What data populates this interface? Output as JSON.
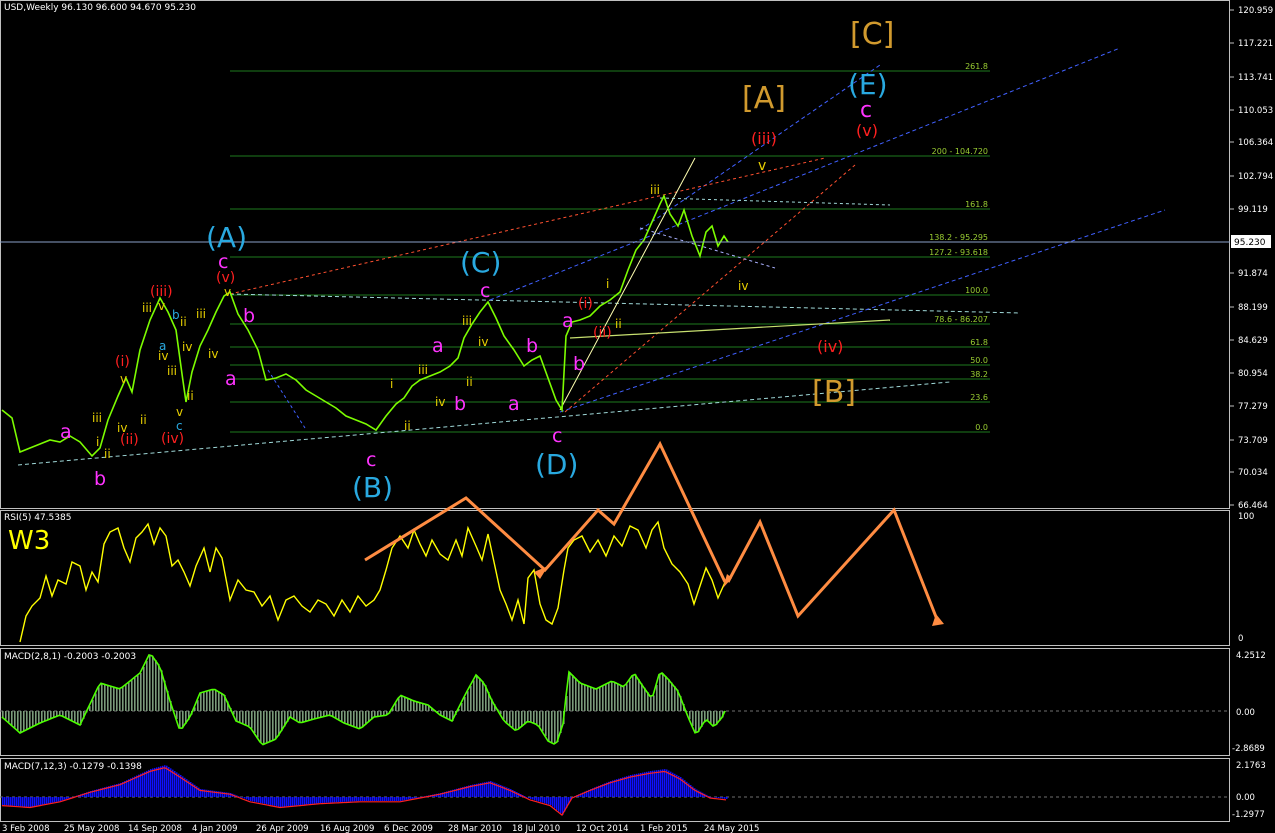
{
  "colors": {
    "background": "#000000",
    "frame": "#c0c0c0",
    "price": "#7cfc00",
    "fib": "#1e7a1e",
    "rsi": "#ffff00",
    "arrow": "#ff8c42",
    "wave_A_label": "#29a9e0",
    "wave_bracket_label": "#d19a2e",
    "magenta": "#ff33ff",
    "red_label": "#ff2020",
    "yellow_label": "#e8d000",
    "macd_hist": "#7a9a7a",
    "macd_line": "#4cff00",
    "macd2_hist": "#1010ff",
    "macd2_signal": "#ff2020",
    "price_marker_bg": "#ffffff"
  },
  "main_panel": {
    "title": "USD,Weekly  96.130 96.600 94.670 95.230",
    "current_price": "95.230",
    "price_axis": [
      "120.959",
      "117.221",
      "113.741",
      "110.053",
      "106.364",
      "102.794",
      "99.119",
      "95.230",
      "91.874",
      "88.199",
      "84.629",
      "80.954",
      "77.279",
      "73.709",
      "70.034",
      "66.464"
    ],
    "fib_labels": [
      "261.8",
      "200 - 104.720",
      "161.8",
      "138.2 - 95.295",
      "127.2 - 93.618",
      "100.0",
      "78.6 - 86.207",
      "61.8",
      "50.0",
      "38.2",
      "23.6",
      "0.0"
    ]
  },
  "wave_labels": {
    "A_paren": "(A)",
    "B_paren": "(B)",
    "C_paren": "(C)",
    "D_paren": "(D)",
    "E_paren": "(E)",
    "A_bracket": "[A]",
    "B_bracket": "[B]",
    "C_bracket": "[C]",
    "a": "a",
    "b": "b",
    "c": "c",
    "i_paren": "(i)",
    "ii_paren": "(ii)",
    "iii_paren": "(iii)",
    "iv_paren": "(iv)",
    "v_paren": "(v)",
    "i": "i",
    "ii": "ii",
    "iii": "iii",
    "iv": "iv",
    "v": "v"
  },
  "rsi_panel": {
    "title": "RSI(5) 47.5385",
    "badge": "W3",
    "axis": [
      "100",
      "0"
    ]
  },
  "macd1_panel": {
    "title": "MACD(2,8,1) -0.2003 -0.2003",
    "axis": [
      "4.2512",
      "0.00",
      "-2.8689"
    ]
  },
  "macd2_panel": {
    "title": "MACD(7,12,3) -0.1279 -0.1398",
    "axis": [
      "2.1763",
      "0.00",
      "-1.2977"
    ]
  },
  "time_axis": [
    "3 Feb 2008",
    "25 May 2008",
    "14 Sep 2008",
    "4 Jan 2009",
    "26 Apr 2009",
    "16 Aug 2009",
    "6 Dec 2009",
    "28 Mar 2010",
    "18 Jul 2010",
    "12 Oct 2014",
    "1 Feb 2015",
    "24 May 2015"
  ],
  "chart_data": {
    "type": "line",
    "title": "USD,Weekly",
    "ohlc_last": {
      "open": 96.13,
      "high": 96.6,
      "low": 94.67,
      "close": 95.23
    },
    "x": [
      "3 Feb 2008",
      "25 May 2008",
      "14 Sep 2008",
      "4 Jan 2009",
      "26 Apr 2009",
      "16 Aug 2009",
      "6 Dec 2009",
      "28 Mar 2010",
      "18 Jul 2010",
      "12 Oct 2014",
      "1 Feb 2015",
      "24 May 2015"
    ],
    "series": [
      {
        "name": "USD",
        "values": [
          73.5,
          72.5,
          86.5,
          88.2,
          81.5,
          77.5,
          75.0,
          82.5,
          84.5,
          86.5,
          99.5,
          95.23
        ]
      }
    ],
    "ylim": [
      66.464,
      120.959
    ],
    "indicators": [
      {
        "name": "RSI(5)",
        "last": 47.5385,
        "range": [
          0,
          100
        ]
      },
      {
        "name": "MACD(2,8,1)",
        "last": -0.2003,
        "signal": -0.2003,
        "range": [
          -2.8689,
          4.2512
        ]
      },
      {
        "name": "MACD(7,12,3)",
        "last": -0.1279,
        "signal": -0.1398,
        "range": [
          -1.2977,
          2.1763
        ]
      }
    ]
  }
}
